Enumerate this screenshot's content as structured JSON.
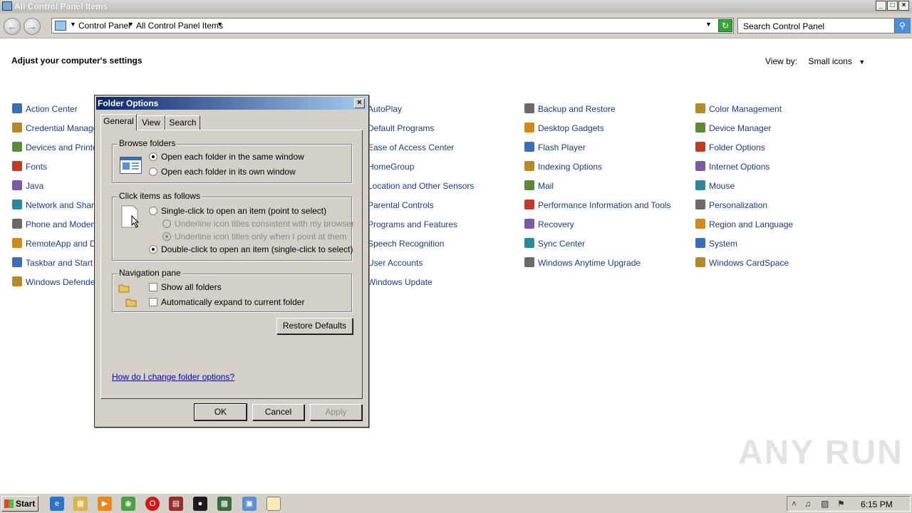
{
  "window": {
    "title": "All Control Panel Items"
  },
  "address": {
    "crumbs": [
      "Control Panel",
      "All Control Panel Items"
    ],
    "search_placeholder": "Search Control Panel"
  },
  "page": {
    "heading": "Adjust your computer's settings",
    "view_by_label": "View by:",
    "view_by_value": "Small icons"
  },
  "items": {
    "col1": [
      "Action Center",
      "Credential Manager",
      "Devices and Printers",
      "Fonts",
      "Java",
      "Network and Sharing",
      "Phone and Modem",
      "RemoteApp and Des",
      "Taskbar and Start M",
      "Windows Defender"
    ],
    "col2": [
      "AutoPlay",
      "Default Programs",
      "Ease of Access Center",
      "HomeGroup",
      "Location and Other Sensors",
      "Parental Controls",
      "Programs and Features",
      "Speech Recognition",
      "User Accounts",
      "Windows Update"
    ],
    "col3": [
      "Backup and Restore",
      "Desktop Gadgets",
      "Flash Player",
      "Indexing Options",
      "Mail",
      "Performance Information and Tools",
      "Recovery",
      "Sync Center",
      "Windows Anytime Upgrade"
    ],
    "col4": [
      "Color Management",
      "Device Manager",
      "Folder Options",
      "Internet Options",
      "Mouse",
      "Personalization",
      "Region and Language",
      "System",
      "Windows CardSpace"
    ]
  },
  "dialog": {
    "title": "Folder Options",
    "tabs": [
      "General",
      "View",
      "Search"
    ],
    "browse": {
      "title": "Browse folders",
      "opt_same": "Open each folder in the same window",
      "opt_own": "Open each folder in its own window"
    },
    "click": {
      "title": "Click items as follows",
      "opt_single": "Single-click to open an item (point to select)",
      "opt_underline_browser": "Underline icon titles consistent with my browser",
      "opt_underline_point": "Underline icon titles only when I point at them",
      "opt_double": "Double-click to open an item (single-click to select)"
    },
    "nav": {
      "title": "Navigation pane",
      "opt_show_all": "Show all folders",
      "opt_expand": "Automatically expand to current folder"
    },
    "restore_label": "Restore Defaults",
    "help_link": "How do I change folder options?",
    "ok_label": "OK",
    "cancel_label": "Cancel",
    "apply_label": "Apply"
  },
  "taskbar": {
    "start_label": "Start",
    "clock": "6:15 PM"
  },
  "watermark": "ANY RUN"
}
